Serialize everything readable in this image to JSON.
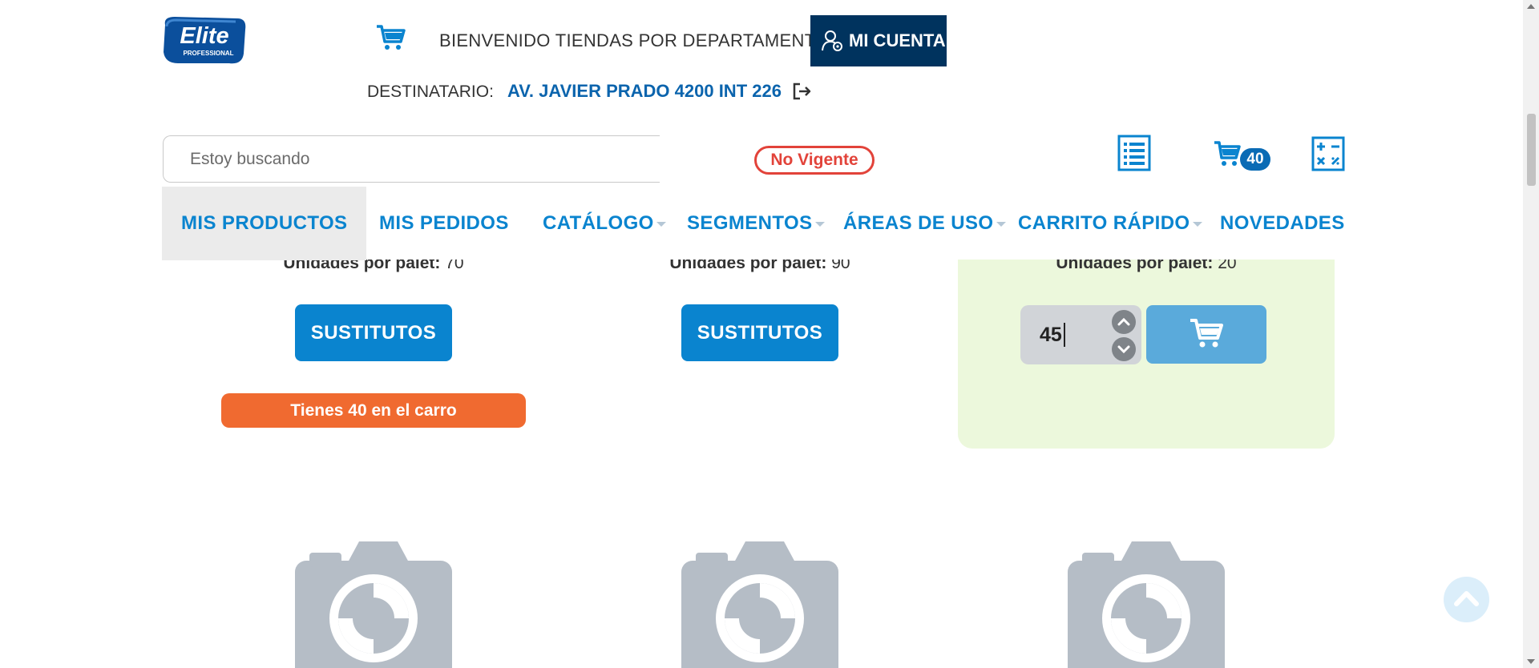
{
  "header": {
    "logo_text": "Elite",
    "logo_sub": "PROFESSIONAL",
    "welcome": "BIENVENIDO TIENDAS POR DEPARTAMENTO",
    "account_label": "MI CUENTA",
    "destination_label": "DESTINATARIO:",
    "destination_value": "AV. JAVIER PRADO 4200 INT 226",
    "search_placeholder": "Estoy buscando",
    "status": "No Vigente",
    "cart_count": "40"
  },
  "nav": {
    "items": [
      {
        "label": "MIS PRODUCTOS"
      },
      {
        "label": "MIS PEDIDOS"
      },
      {
        "label": "CATÁLOGO"
      },
      {
        "label": "SEGMENTOS"
      },
      {
        "label": "ÁREAS DE USO"
      },
      {
        "label": "CARRITO RÁPIDO"
      },
      {
        "label": "NOVEDADES"
      }
    ]
  },
  "products": [
    {
      "units_label": "Unidades por palet:",
      "units_value": "70",
      "action_label": "SUSTITUTOS",
      "in_cart": "Tienes 40 en el carro"
    },
    {
      "units_label": "Unidades por palet:",
      "units_value": "90",
      "action_label": "SUSTITUTOS"
    },
    {
      "units_label": "Unidades por palet:",
      "units_value": "20",
      "quantity": "45"
    }
  ],
  "colors": {
    "brand_blue": "#0a84cf",
    "dark_navy": "#00335e",
    "status_red": "#e2433a",
    "in_cart_orange": "#f06a30",
    "card_green": "#ecf8dc"
  }
}
